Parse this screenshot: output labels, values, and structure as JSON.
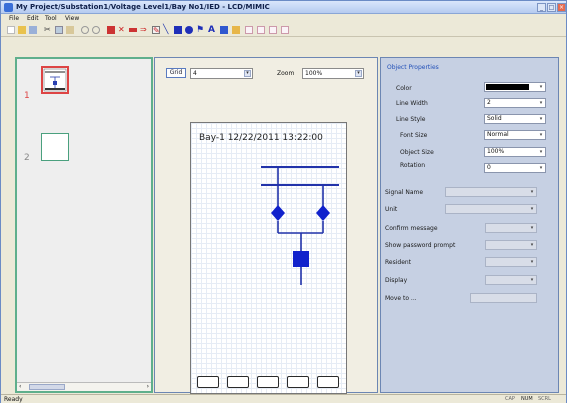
{
  "window": {
    "title": "My Project/Substation1/Voltage Level1/Bay No1/IED - LCD/MIMIC"
  },
  "menu": [
    "File",
    "Edit",
    "Tool",
    "View"
  ],
  "left": {
    "pages": [
      "1",
      "2"
    ]
  },
  "center": {
    "grid_label": "Grid",
    "grid_value": "4",
    "zoom_label": "Zoom",
    "zoom_value": "100%",
    "bay_header": "Bay-1   12/22/2011 13:22:00"
  },
  "props": {
    "title": "Object Properties",
    "color_label": "Color",
    "color_value": "#000000",
    "line_width_label": "Line Width",
    "line_width_value": "2",
    "line_style_label": "Line Style",
    "line_style_value": "Solid",
    "font_size_label": "Font Size",
    "font_size_value": "Normal",
    "object_size_label": "Object Size",
    "object_size_value": "100%",
    "rotation_label": "Rotation",
    "rotation_value": "0",
    "signal_name_label": "Signal Name",
    "unit_label": "Unit",
    "confirm_label": "Confirm message",
    "password_label": "Show password prompt",
    "resident_label": "Resident",
    "display_label": "Display",
    "move_label": "Move to ..."
  },
  "status": {
    "text": "Ready",
    "cap": "CAP",
    "num": "NUM",
    "scrl": "SCRL"
  }
}
